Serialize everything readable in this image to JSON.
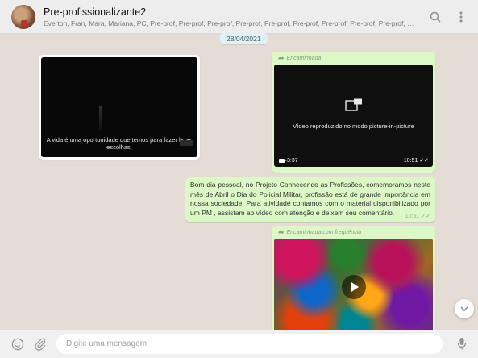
{
  "header": {
    "title": "Pre-profissionalizante2",
    "members": "Everton, Fran, Mara, Mariana, PC, Pre-prof, Pre-prof, Pre-prof, Pre-prof, Pre-prof, Pre-prof, Pre-prof, Pre-prof, Pre-prof, Pre-prof, Pre-prof, Pre-prof, Pre-prof...",
    "icons": [
      "search-icon",
      "menu-icon"
    ]
  },
  "chat": {
    "date": "28/04/2021",
    "incoming_video": {
      "subtitle": "A vida é uma oportunidade que temos para fazer boas escolhas."
    },
    "pip_message": {
      "forwarded_label": "Encaminhada",
      "overlay_text": "Vídeo reproduzido no modo picture-in-picture",
      "duration": "3:37",
      "time": "10:51"
    },
    "text_message": {
      "text": "Bom dia pessoal, no Projeto Conhecendo as Profissões, comemoramos neste mês de Abril o Dia do Policial Militar, profissão está de grande importância em nossa sociedade. Para atividade contamos com o material disponibilizado por um PM , assistam ao vídeo com atenção e deixem seu comentário.",
      "time": "10:51"
    },
    "colorful_message": {
      "forwarded_label": "Encaminhada com frequência"
    }
  },
  "footer": {
    "placeholder": "Digite uma mensagem",
    "icons": [
      "emoji-icon",
      "attach-icon",
      "mic-icon"
    ]
  },
  "colors": {
    "chat_background": "#e5ddd5",
    "outgoing_bubble": "#dcf8c6",
    "incoming_bubble": "#ffffff",
    "header_background": "#ededed"
  }
}
